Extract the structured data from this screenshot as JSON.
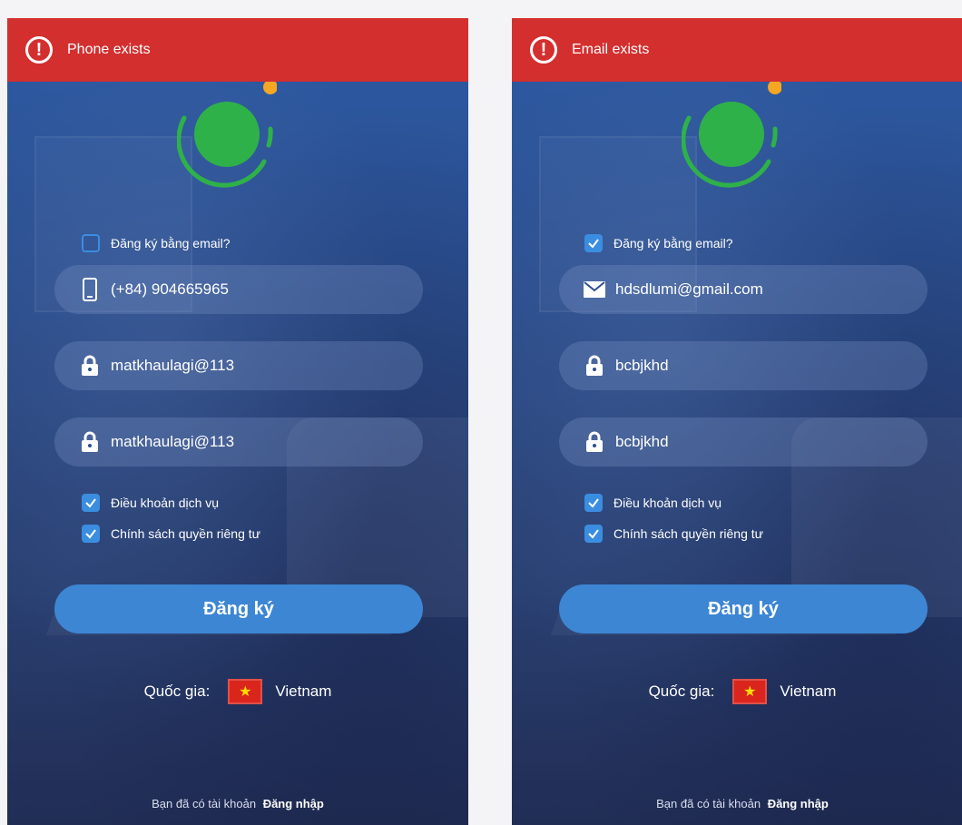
{
  "colors": {
    "error_bar": "#d32f2f",
    "accent_blue": "#3d86d4",
    "logo_green": "#2fb14a",
    "logo_orange": "#f5a623"
  },
  "left_screen": {
    "error_message": "Phone exists",
    "register_by_email": {
      "label": "Đăng ký bằng email?",
      "checked": false
    },
    "identity_field": {
      "icon": "phone-icon",
      "value": "(+84) 904665965"
    },
    "password_field": {
      "icon": "lock-icon",
      "value": "matkhaulagi@113"
    },
    "confirm_password_field": {
      "icon": "lock-icon",
      "value": "matkhaulagi@113"
    },
    "terms": {
      "label": "Điều khoản dịch vụ",
      "checked": true
    },
    "privacy": {
      "label": "Chính sách quyền riêng tư",
      "checked": true
    },
    "submit_label": "Đăng ký",
    "country_label": "Quốc gia:",
    "country_value": "Vietnam",
    "footer_text": "Bạn đã có tài khoản",
    "footer_link": "Đăng nhập"
  },
  "right_screen": {
    "error_message": "Email exists",
    "register_by_email": {
      "label": "Đăng ký bằng email?",
      "checked": true
    },
    "identity_field": {
      "icon": "mail-icon",
      "value": "hdsdlumi@gmail.com"
    },
    "password_field": {
      "icon": "lock-icon",
      "value": "bcbjkhd"
    },
    "confirm_password_field": {
      "icon": "lock-icon",
      "value": "bcbjkhd"
    },
    "terms": {
      "label": "Điều khoản dịch vụ",
      "checked": true
    },
    "privacy": {
      "label": "Chính sách quyền riêng tư",
      "checked": true
    },
    "submit_label": "Đăng ký",
    "country_label": "Quốc gia:",
    "country_value": "Vietnam",
    "footer_text": "Bạn đã có tài khoản",
    "footer_link": "Đăng nhập"
  }
}
